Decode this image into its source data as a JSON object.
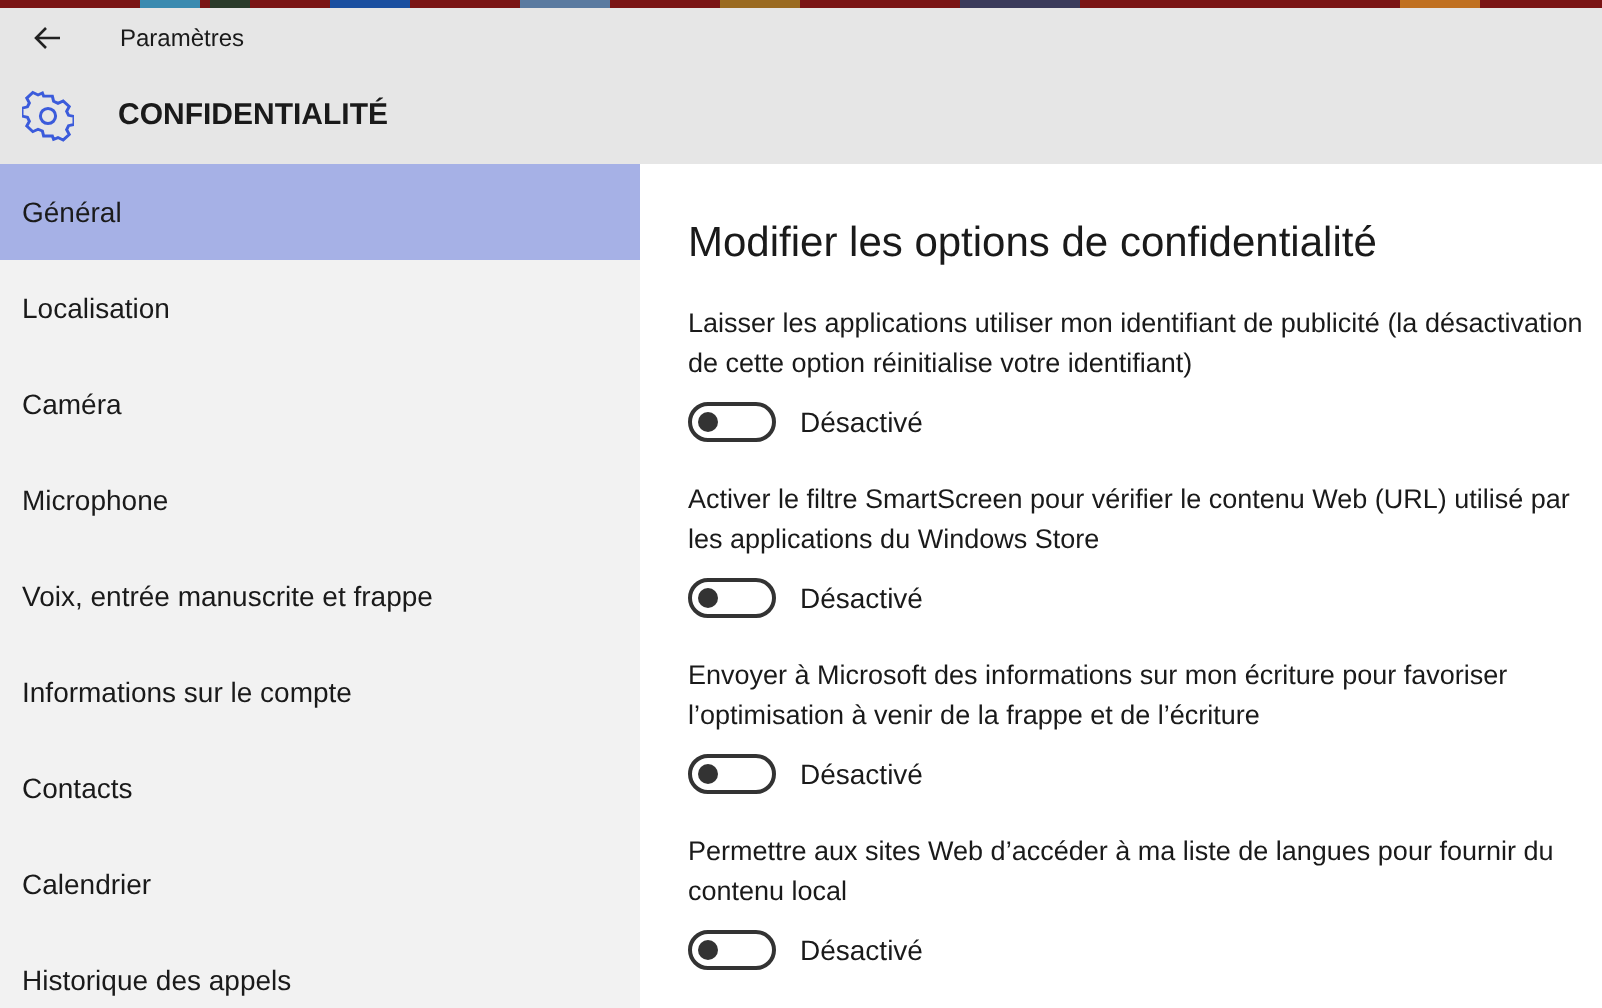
{
  "window": {
    "title": "Paramètres"
  },
  "header": {
    "title": "CONFIDENTIALITÉ"
  },
  "sidebar": {
    "items": [
      {
        "label": "Général",
        "selected": true
      },
      {
        "label": "Localisation",
        "selected": false
      },
      {
        "label": "Caméra",
        "selected": false
      },
      {
        "label": "Microphone",
        "selected": false
      },
      {
        "label": "Voix, entrée manuscrite et frappe",
        "selected": false
      },
      {
        "label": "Informations sur le compte",
        "selected": false
      },
      {
        "label": "Contacts",
        "selected": false
      },
      {
        "label": "Calendrier",
        "selected": false
      },
      {
        "label": "Historique des appels",
        "selected": false
      }
    ]
  },
  "content": {
    "heading": "Modifier les options de confidentialité",
    "options": [
      {
        "description": "Laisser les applications utiliser mon identifiant de publicité (la désactivation de cette option réinitialise votre identifiant)",
        "on": false,
        "state_label": "Désactivé"
      },
      {
        "description": "Activer le filtre SmartScreen pour vérifier le contenu Web (URL) utilisé par les applications du Windows Store",
        "on": false,
        "state_label": "Désactivé"
      },
      {
        "description": "Envoyer à Microsoft des informations sur mon écriture pour favoriser l’optimisation à venir de la frappe et de l’écriture",
        "on": false,
        "state_label": "Désactivé"
      },
      {
        "description": "Permettre aux sites Web d’accéder à ma liste de langues pour fournir du contenu local",
        "on": false,
        "state_label": "Désactivé"
      }
    ]
  }
}
